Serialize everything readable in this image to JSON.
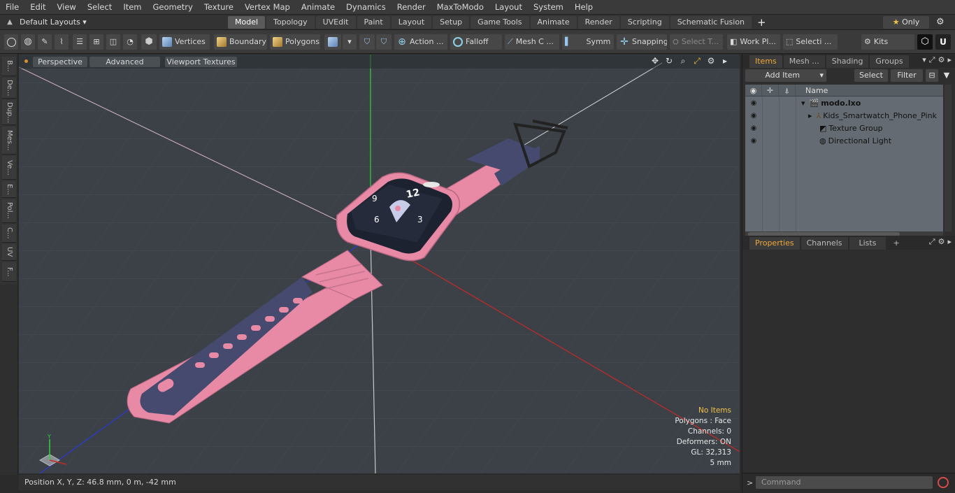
{
  "menu": [
    "File",
    "Edit",
    "View",
    "Select",
    "Item",
    "Geometry",
    "Texture",
    "Vertex Map",
    "Animate",
    "Dynamics",
    "Render",
    "MaxToModo",
    "Layout",
    "System",
    "Help"
  ],
  "layout_selector": "Default Layouts ▾",
  "layout_tabs": [
    "Model",
    "Topology",
    "UVEdit",
    "Paint",
    "Layout",
    "Setup",
    "Game Tools",
    "Animate",
    "Render",
    "Scripting",
    "Schematic Fusion"
  ],
  "active_layout_tab": "Model",
  "only_label": "Only",
  "toolbar": {
    "vertices": "Vertices",
    "boundary": "Boundary",
    "polygons": "Polygons",
    "action": "Action ...",
    "falloff": "Falloff",
    "mesh": "Mesh C ...",
    "symm": "Symm ...",
    "snapping": "Snapping",
    "select_t": "Select T...",
    "work_pl": "Work Pl...",
    "selecti": "Selecti ...",
    "kits": "Kits"
  },
  "left_tabs": [
    "B...",
    "De...",
    "Dup...",
    "Mes...",
    "Ve...",
    "E...",
    "Pol...",
    "C...",
    "UV",
    "F..."
  ],
  "viewport": {
    "perspective": "Perspective",
    "advanced": "Advanced",
    "viewport_textures": "Viewport Textures",
    "stats": {
      "no_items": "No Items",
      "polygons": "Polygons : Face",
      "channels": "Channels: 0",
      "deformers": "Deformers: ON",
      "gl": "GL: 32,313",
      "scale": "5 mm"
    }
  },
  "status": "Position X, Y, Z:  46.8 mm, 0 m, -42 mm",
  "items_panel": {
    "tabs": [
      "Items",
      "Mesh ...",
      "Shading",
      "Groups"
    ],
    "add_item": "Add Item",
    "select": "Select",
    "filter": "Filter",
    "name_header": "Name",
    "rows": [
      {
        "label": "modo.lxo",
        "bold": true
      },
      {
        "label": "Kids_Smartwatch_Phone_Pink"
      },
      {
        "label": "Texture Group"
      },
      {
        "label": "Directional Light"
      }
    ]
  },
  "props_panel": {
    "tabs": [
      "Properties",
      "Channels",
      "Lists"
    ]
  },
  "command_placeholder": "Command"
}
